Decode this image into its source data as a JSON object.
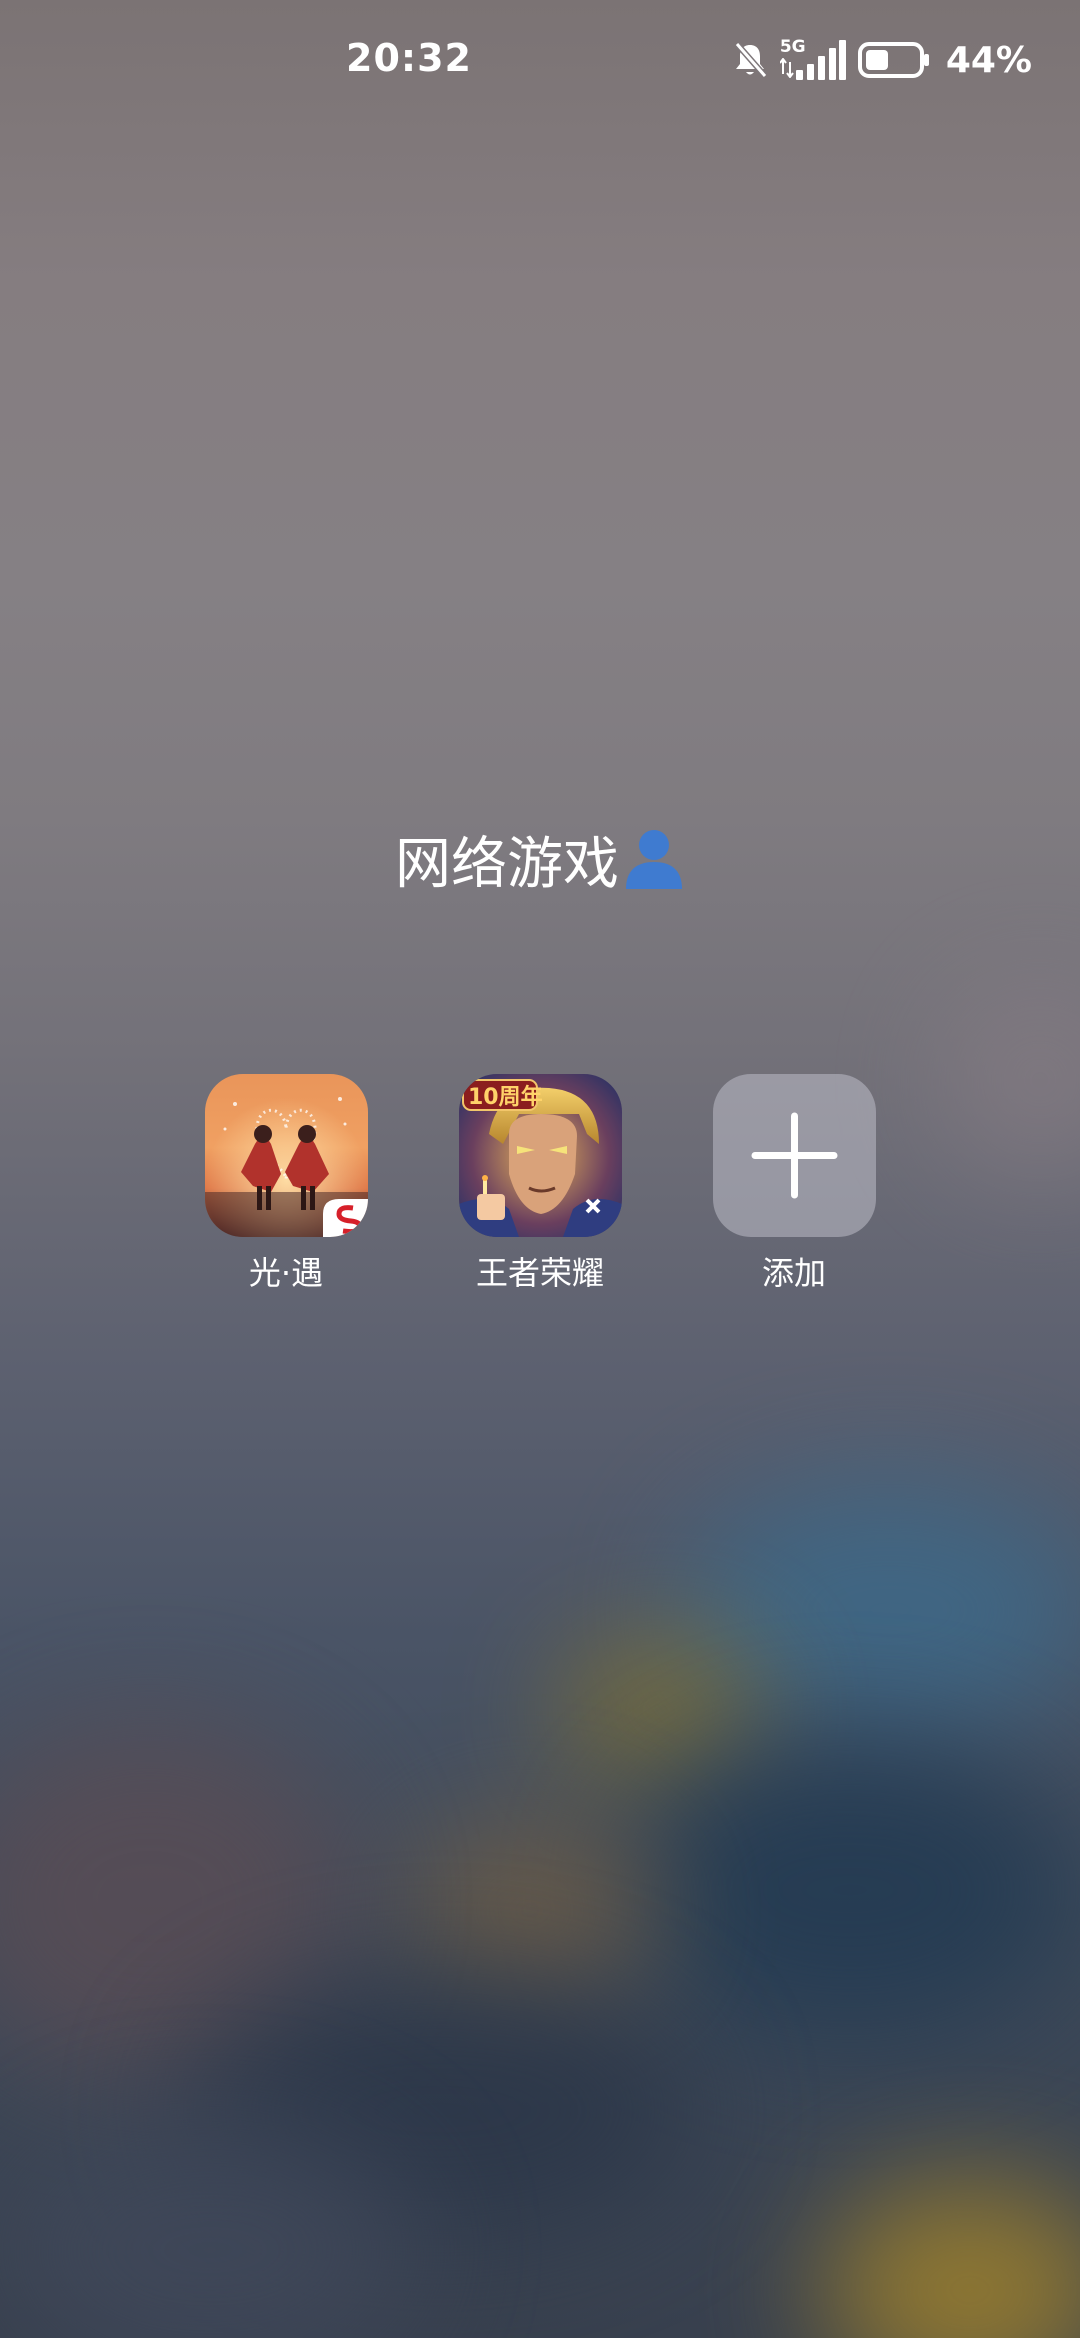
{
  "status_bar": {
    "time": "20:32",
    "network": "5G",
    "battery_percent": "44%",
    "battery_level": 0.44,
    "silent_mode": true
  },
  "folder": {
    "title": "网络游戏",
    "title_icon": "person-icon"
  },
  "apps": [
    {
      "label": "光·遇",
      "icon": "sky-app-icon"
    },
    {
      "label": "王者荣耀",
      "icon": "honor-of-kings-app-icon",
      "badge_text": "10周年"
    },
    {
      "label": "添加",
      "icon": "add-icon"
    }
  ],
  "colors": {
    "person_icon": "#3f7bd0",
    "add_tile": "#b8b6c0"
  }
}
